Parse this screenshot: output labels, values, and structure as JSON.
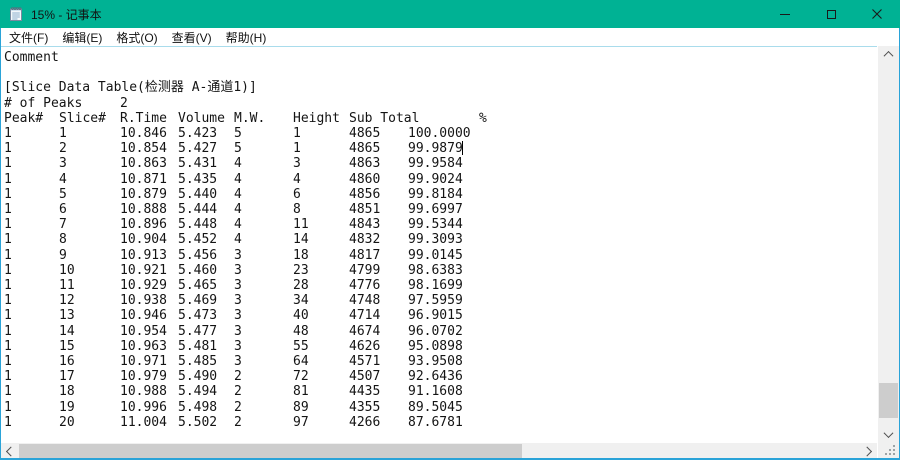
{
  "window": {
    "title": "15% - 记事本"
  },
  "icons": {
    "app": "notepad-icon",
    "minimize": "minimize-icon",
    "maximize": "maximize-icon",
    "close": "close-icon",
    "scroll_up": "chevron-up-icon",
    "scroll_down": "chevron-down-icon",
    "scroll_left": "chevron-left-icon",
    "scroll_right": "chevron-right-icon",
    "resize": "resize-grip-icon"
  },
  "colors": {
    "titlebar": "#00b294",
    "window_border": "#2aa3d8",
    "scrollbar_track": "#f0f0f0",
    "scrollbar_thumb": "#cdcdcd",
    "editor_text": "#141414"
  },
  "menu": {
    "items": [
      "文件(F)",
      "编辑(E)",
      "格式(O)",
      "查看(V)",
      "帮助(H)"
    ]
  },
  "editor": {
    "comment": "Comment",
    "table_title": "[Slice Data Table(检测器 A-通道1)]",
    "peaks_label": "# of Peaks",
    "peaks_value": "2",
    "columns": [
      "Peak#",
      "Slice#",
      "R.Time",
      "Volume",
      "M.W.",
      "Height",
      "Sub Total",
      "%"
    ],
    "rows": [
      [
        "1",
        "1",
        "10.846",
        "5.423",
        "5",
        "1",
        "4865",
        "100.0000"
      ],
      [
        "1",
        "2",
        "10.854",
        "5.427",
        "5",
        "1",
        "4865",
        "99.9879"
      ],
      [
        "1",
        "3",
        "10.863",
        "5.431",
        "4",
        "3",
        "4863",
        "99.9584"
      ],
      [
        "1",
        "4",
        "10.871",
        "5.435",
        "4",
        "4",
        "4860",
        "99.9024"
      ],
      [
        "1",
        "5",
        "10.879",
        "5.440",
        "4",
        "6",
        "4856",
        "99.8184"
      ],
      [
        "1",
        "6",
        "10.888",
        "5.444",
        "4",
        "8",
        "4851",
        "99.6997"
      ],
      [
        "1",
        "7",
        "10.896",
        "5.448",
        "4",
        "11",
        "4843",
        "99.5344"
      ],
      [
        "1",
        "8",
        "10.904",
        "5.452",
        "4",
        "14",
        "4832",
        "99.3093"
      ],
      [
        "1",
        "9",
        "10.913",
        "5.456",
        "3",
        "18",
        "4817",
        "99.0145"
      ],
      [
        "1",
        "10",
        "10.921",
        "5.460",
        "3",
        "23",
        "4799",
        "98.6383"
      ],
      [
        "1",
        "11",
        "10.929",
        "5.465",
        "3",
        "28",
        "4776",
        "98.1699"
      ],
      [
        "1",
        "12",
        "10.938",
        "5.469",
        "3",
        "34",
        "4748",
        "97.5959"
      ],
      [
        "1",
        "13",
        "10.946",
        "5.473",
        "3",
        "40",
        "4714",
        "96.9015"
      ],
      [
        "1",
        "14",
        "10.954",
        "5.477",
        "3",
        "48",
        "4674",
        "96.0702"
      ],
      [
        "1",
        "15",
        "10.963",
        "5.481",
        "3",
        "55",
        "4626",
        "95.0898"
      ],
      [
        "1",
        "16",
        "10.971",
        "5.485",
        "3",
        "64",
        "4571",
        "93.9508"
      ],
      [
        "1",
        "17",
        "10.979",
        "5.490",
        "2",
        "72",
        "4507",
        "92.6436"
      ],
      [
        "1",
        "18",
        "10.988",
        "5.494",
        "2",
        "81",
        "4435",
        "91.1608"
      ],
      [
        "1",
        "19",
        "10.996",
        "5.498",
        "2",
        "89",
        "4355",
        "89.5045"
      ],
      [
        "1",
        "20",
        "11.004",
        "5.502",
        "2",
        "97",
        "4266",
        "87.6781"
      ]
    ]
  }
}
